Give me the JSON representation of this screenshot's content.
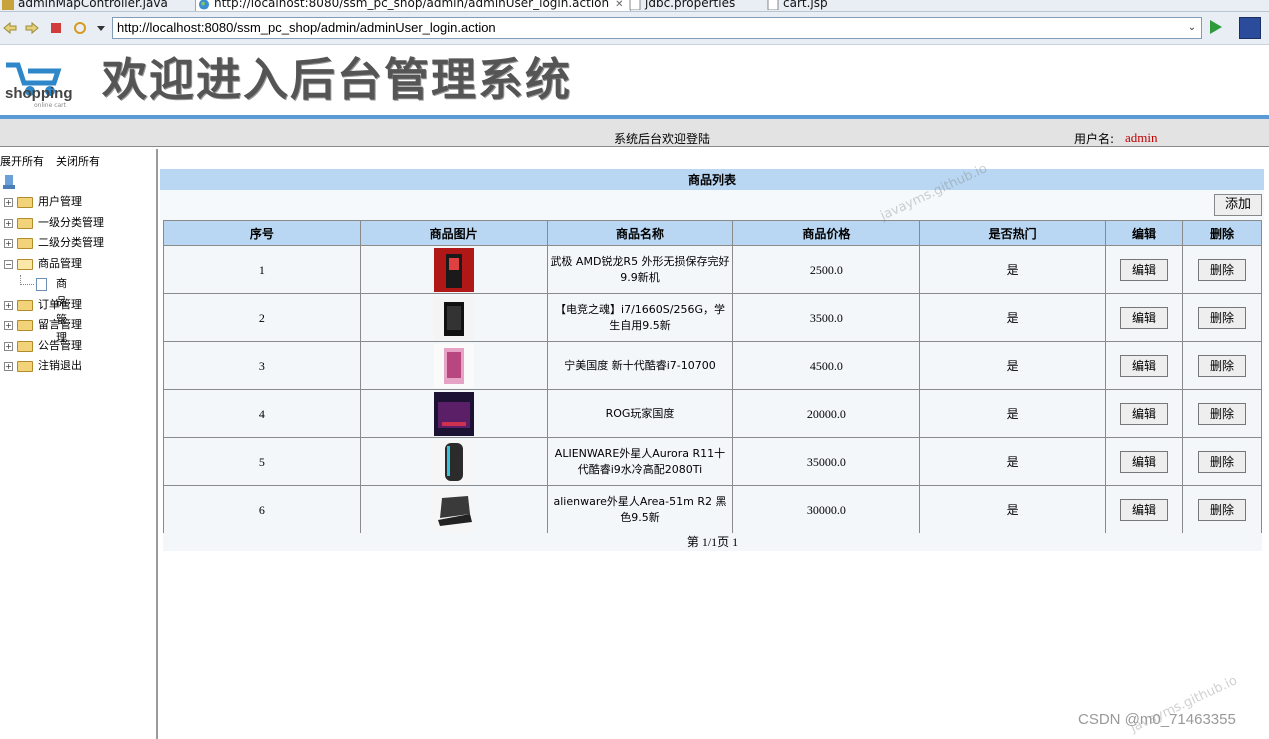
{
  "editor_tabs": [
    {
      "label": "adminMapController.java"
    },
    {
      "label": "http://localhost:8080/ssm_pc_shop/admin/adminUser_login.action"
    },
    {
      "label": "jdbc.properties"
    },
    {
      "label": "cart.jsp"
    }
  ],
  "browser": {
    "url": "http://localhost:8080/ssm_pc_shop/admin/adminUser_login.action"
  },
  "header": {
    "logo_text": "shopping",
    "logo_subtext": "online cart",
    "title": "欢迎进入后台管理系统",
    "welcome": "系统后台欢迎登陆",
    "user_label": "用户名:",
    "user_name": "admin"
  },
  "sidebar": {
    "expand_all": "展开所有",
    "collapse_all": "关闭所有",
    "items": [
      {
        "label": "用户管理"
      },
      {
        "label": "一级分类管理"
      },
      {
        "label": "二级分类管理"
      },
      {
        "label": "商品管理"
      },
      {
        "label": "订单管理"
      },
      {
        "label": "留言管理"
      },
      {
        "label": "公告管理"
      },
      {
        "label": "注销退出"
      }
    ],
    "subitem": {
      "label": "商品管理"
    }
  },
  "list": {
    "title": "商品列表",
    "add_label": "添加",
    "columns": [
      "序号",
      "商品图片",
      "商品名称",
      "商品价格",
      "是否热门",
      "编辑",
      "删除"
    ],
    "rows": [
      {
        "no": "1",
        "name": "武极 AMD锐龙R5 外形无损保存完好9.9新机",
        "price": "2500.0",
        "hot": "是",
        "edit": "编辑",
        "del": "删除"
      },
      {
        "no": "2",
        "name": "【电竞之魂】i7/1660S/256G，学生自用9.5新",
        "price": "3500.0",
        "hot": "是",
        "edit": "编辑",
        "del": "删除"
      },
      {
        "no": "3",
        "name": "宁美国度 新十代酷睿i7-10700",
        "price": "4500.0",
        "hot": "是",
        "edit": "编辑",
        "del": "删除"
      },
      {
        "no": "4",
        "name": "ROG玩家国度",
        "price": "20000.0",
        "hot": "是",
        "edit": "编辑",
        "del": "删除"
      },
      {
        "no": "5",
        "name": "ALIENWARE外星人Aurora R11十代酷睿i9水冷高配2080Ti",
        "price": "35000.0",
        "hot": "是",
        "edit": "编辑",
        "del": "删除"
      },
      {
        "no": "6",
        "name": "alienware外星人Area-51m R2 黑色9.5新",
        "price": "30000.0",
        "hot": "是",
        "edit": "编辑",
        "del": "删除"
      }
    ],
    "pager": "第 1/1页 1"
  },
  "watermarks": {
    "mark1": "javayms.github.io",
    "mark2": "javayms.github.io",
    "csdn": "CSDN @m0_71463355"
  }
}
